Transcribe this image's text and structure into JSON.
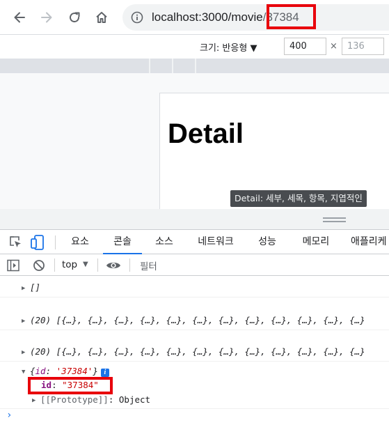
{
  "browser": {
    "url_host": "localhost:3000/movie",
    "url_path": "/37384"
  },
  "device_toolbar": {
    "size_label": "크기: 반응형 ▼",
    "width": "400",
    "height": "136",
    "times": "×"
  },
  "page": {
    "title": "Detail",
    "tooltip": "Detail: 세부, 세목, 항목, 지엽적인"
  },
  "devtools": {
    "tabs": [
      "요소",
      "콘솔",
      "소스",
      "네트워크",
      "성능",
      "메모리",
      "애플리케"
    ],
    "active_tab": "콘솔",
    "context": "top",
    "filter_placeholder": "필터"
  },
  "console": {
    "line1": "[]",
    "line2": "(20) [{…}, {…}, {…}, {…}, {…}, {…}, {…}, {…}, {…}, {…}, {…}, {…}",
    "line3": "(20) [{…}, {…}, {…}, {…}, {…}, {…}, {…}, {…}, {…}, {…}, {…}, {…}",
    "obj_open": "{",
    "obj_key": "id",
    "obj_colon": ": ",
    "obj_value": "'37384'",
    "obj_close": "}",
    "info_badge": "i",
    "prop_key": "id",
    "prop_colon": ": ",
    "prop_value": "\"37384\"",
    "proto": "[[Prototype]]",
    "proto_sep": ": ",
    "proto_value": "Object",
    "prompt": "›"
  },
  "colors": {
    "highlight": "#e8000b",
    "accent": "#1a73e8"
  }
}
